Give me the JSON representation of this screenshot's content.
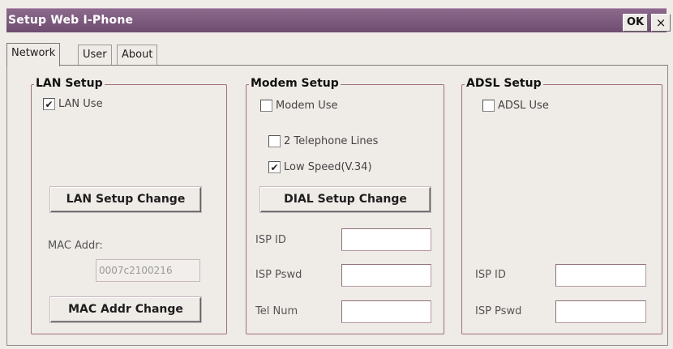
{
  "window": {
    "title": "Setup Web I-Phone",
    "ok_label": "OK",
    "close_label": "×"
  },
  "tabs": [
    {
      "label": "Network",
      "active": true
    },
    {
      "label": "User",
      "active": false
    },
    {
      "label": "About",
      "active": false
    }
  ],
  "lan": {
    "title": "LAN Setup",
    "use_label": "LAN Use",
    "use_checked": true,
    "setup_change_label": "LAN Setup Change",
    "mac_label": "MAC Addr:",
    "mac_value": "0007c2100216",
    "mac_change_label": "MAC Addr Change"
  },
  "modem": {
    "title": "Modem Setup",
    "use_label": "Modem Use",
    "use_checked": false,
    "two_lines_label": "2 Telephone Lines",
    "two_lines_checked": false,
    "low_speed_label": "Low Speed(V.34)",
    "low_speed_checked": true,
    "dial_change_label": "DIAL Setup Change",
    "isp_id_label": "ISP ID",
    "isp_id_value": "",
    "isp_pswd_label": "ISP Pswd",
    "isp_pswd_value": "",
    "tel_num_label": "Tel Num",
    "tel_num_value": ""
  },
  "adsl": {
    "title": "ADSL Setup",
    "use_label": "ADSL Use",
    "use_checked": false,
    "isp_id_label": "ISP ID",
    "isp_id_value": "",
    "isp_pswd_label": "ISP Pswd",
    "isp_pswd_value": ""
  },
  "check_glyph": "✔",
  "colors": {
    "titlebar": "#7a5a7c",
    "background": "#efebe7",
    "group_border": "#a07080"
  }
}
